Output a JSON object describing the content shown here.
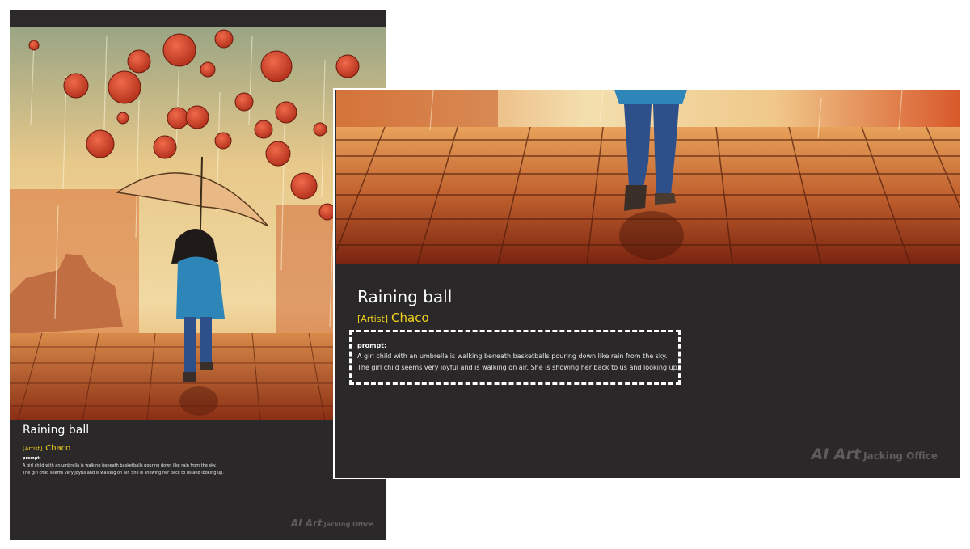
{
  "poster": {
    "title": "Raining ball",
    "artist_tag": "[Artist]",
    "artist_name": "Chaco",
    "prompt_label": "prompt:",
    "prompt_line1": "A girl child with an umbrella is walking beneath basketballs pouring down like rain from the sky.",
    "prompt_line2": "The girl child seems very joyful and is walking on air. She is showing her back to us and looking up.",
    "logo_mark": "AI Art",
    "logo_text": "Jacking Office"
  },
  "panel": {
    "title": "Raining ball",
    "artist_tag": "[Artist]",
    "artist_name": "Chaco",
    "prompt_label": "prompt:",
    "prompt_line1": "A girl child with an umbrella is walking beneath basketballs pouring down like rain from the sky.",
    "prompt_line2": "The girl child seems very joyful and is walking on air. She is showing her back to us and looking up.",
    "logo_mark": "AI Art",
    "logo_text": "Jacking Office"
  },
  "colors": {
    "card_bg": "#2a2829",
    "accent_yellow": "#f2d21c",
    "ball_red": "#d9442a",
    "jacket_blue": "#2e86b8",
    "jeans_blue": "#2d4f8a",
    "umbrella": "#e8b882",
    "brick": "#b8522a"
  }
}
